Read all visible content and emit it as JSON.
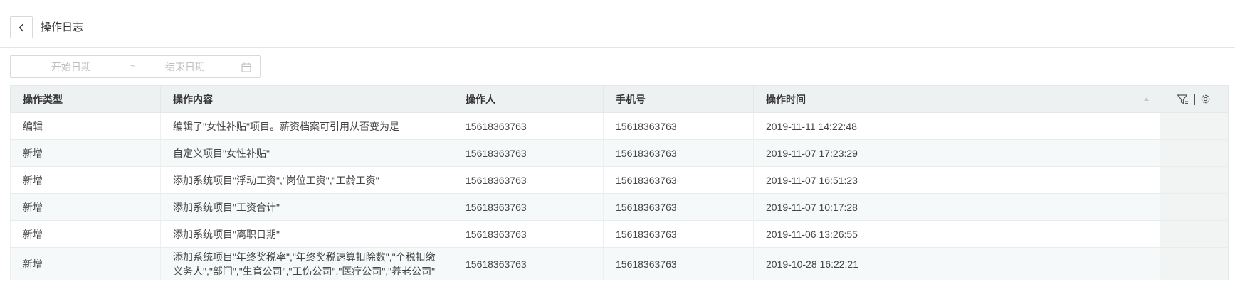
{
  "header": {
    "title": "操作日志",
    "back_icon": "chevron-left-icon"
  },
  "filter": {
    "start_placeholder": "开始日期",
    "separator": "~",
    "end_placeholder": "结束日期",
    "calendar_icon": "calendar-icon"
  },
  "table": {
    "columns": [
      "操作类型",
      "操作内容",
      "操作人",
      "手机号",
      "操作时间"
    ],
    "tool_icons": [
      "filter-icon",
      "gear-icon"
    ],
    "rows": [
      {
        "type": "编辑",
        "content": "编辑了\"女性补贴\"项目。薪资档案可引用从否变为是",
        "operator": "15618363763",
        "phone": "15618363763",
        "time": "2019-11-11 14:22:48"
      },
      {
        "type": "新增",
        "content": "自定义项目\"女性补贴\"",
        "operator": "15618363763",
        "phone": "15618363763",
        "time": "2019-11-07 17:23:29"
      },
      {
        "type": "新增",
        "content": "添加系统项目\"浮动工资\",\"岗位工资\",\"工龄工资\"",
        "operator": "15618363763",
        "phone": "15618363763",
        "time": "2019-11-07 16:51:23"
      },
      {
        "type": "新增",
        "content": "添加系统项目\"工资合计\"",
        "operator": "15618363763",
        "phone": "15618363763",
        "time": "2019-11-07 10:17:28"
      },
      {
        "type": "新增",
        "content": "添加系统项目\"离职日期\"",
        "operator": "15618363763",
        "phone": "15618363763",
        "time": "2019-11-06 13:26:55"
      },
      {
        "type": "新增",
        "content": "添加系统项目\"年终奖税率\",\"年终奖税速算扣除数\",\"个税扣缴义务人\",\"部门\",\"生育公司\",\"工伤公司\",\"医疗公司\",\"养老公司\"",
        "operator": "15618363763",
        "phone": "15618363763",
        "time": "2019-10-28 16:22:21"
      }
    ]
  },
  "colors": {
    "header_bg": "#eef1f1",
    "stripe_bg": "#f5f9f9",
    "border": "#e4e8e8",
    "placeholder": "#bfbfbf"
  }
}
